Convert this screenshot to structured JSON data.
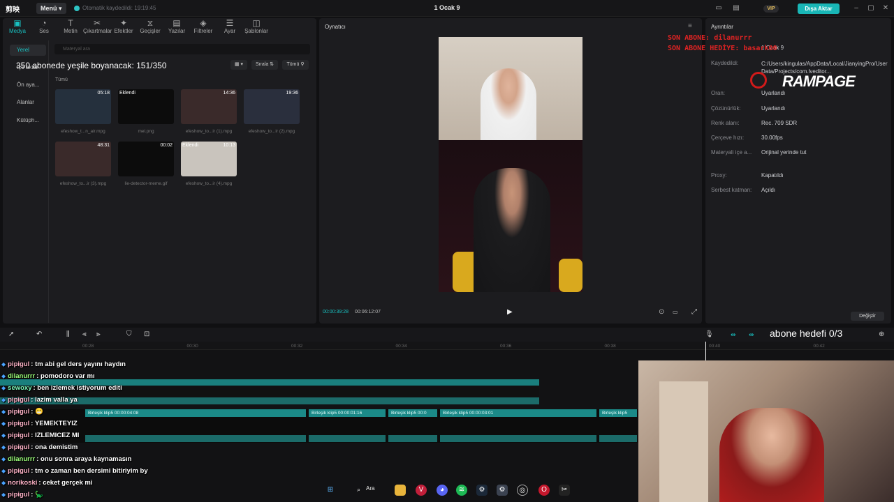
{
  "app": {
    "logo": "剪映",
    "menu_label": "Menü",
    "autosave_text": "Otomatik kaydedildi: 19:19:45",
    "project_title": "1 Ocak 9",
    "vip_label": "VIP",
    "export_label": "Dışa Aktar"
  },
  "toolbar": [
    {
      "label": "Medya",
      "icon": "media-icon"
    },
    {
      "label": "Ses",
      "icon": "audio-icon"
    },
    {
      "label": "Metin",
      "icon": "text-icon"
    },
    {
      "label": "Çıkartmalar",
      "icon": "sticker-icon"
    },
    {
      "label": "Efektler",
      "icon": "effects-icon"
    },
    {
      "label": "Geçişler",
      "icon": "transitions-icon"
    },
    {
      "label": "Yazılar",
      "icon": "captions-icon"
    },
    {
      "label": "Filtreler",
      "icon": "filters-icon"
    },
    {
      "label": "Ayar",
      "icon": "adjust-icon"
    },
    {
      "label": "Şablonlar",
      "icon": "templates-icon"
    }
  ],
  "side_nav": [
    "Yerel",
    "İçe aktar",
    "Ön aya...",
    "Alanlar",
    "Kütüph..."
  ],
  "media": {
    "search_placeholder": "Materyal ara",
    "sort_label": "Sırala",
    "filter_label": "Tümü",
    "all_label": "Tümü",
    "items": [
      {
        "caption": "efeshow_t...n_air.mpg",
        "duration": "05:18",
        "added": ""
      },
      {
        "caption": "mel.png",
        "duration": "",
        "added": "Eklendi"
      },
      {
        "caption": "efeshow_to...ir (1).mpg",
        "duration": "14:36",
        "added": ""
      },
      {
        "caption": "efeshow_to...ir (2).mpg",
        "duration": "19:36",
        "added": ""
      },
      {
        "caption": "efeshow_to...ir (3).mpg",
        "duration": "48:31",
        "added": ""
      },
      {
        "caption": "lie-detector-meme.gif",
        "duration": "00:02",
        "added": ""
      },
      {
        "caption": "efeshow_to...ir (4).mpg",
        "duration": "10:13",
        "added": "Eklendi"
      }
    ]
  },
  "player": {
    "title": "Oynatıcı",
    "current_time": "00:00:39:28",
    "total_time": "00:06:12:07"
  },
  "details": {
    "title": "Ayrıntılar",
    "rows": [
      {
        "label": "",
        "value": "1 Ocak 9"
      },
      {
        "label": "Kaydedildi:",
        "value": "C:/Users/kingulas/AppData/Local/JianyingPro/User Data/Projects/com.lveditor..."
      },
      {
        "label": "Oran:",
        "value": "Uyarlandı"
      },
      {
        "label": "Çözünürlük:",
        "value": "Uyarlandı"
      },
      {
        "label": "Renk alanı:",
        "value": "Rec. 709 SDR"
      },
      {
        "label": "Çerçeve hızı:",
        "value": "30.00fps"
      },
      {
        "label": "Materyali içe a...",
        "value": "Orijinal yerinde tut"
      },
      {
        "label": "Proxy:",
        "value": "Kapatıldı"
      },
      {
        "label": "Serbest katman:",
        "value": "Açıldı"
      }
    ],
    "change_label": "Değiştir"
  },
  "timeline": {
    "ticks": [
      "00:28",
      "00:30",
      "00:32",
      "00:34",
      "00:36",
      "00:38",
      "00:40",
      "00:42"
    ],
    "clips": [
      {
        "label": "Birleşik klip5  00:00:04:08"
      },
      {
        "label": "Birleşik klip5  00:00:01:16"
      },
      {
        "label": "Birleşik klip5  00:0"
      },
      {
        "label": "Birleşik klip5  00:00:03:01"
      },
      {
        "label": "Birleşik klip5"
      }
    ]
  },
  "overlay": {
    "sub_goal": "350 abonede yeşile boyanacak: 151/350",
    "last_sub": "SON ABONE: dilanurrr",
    "last_gift": "SON ABONE HEDİYE: basark00",
    "brand": "RAMPAGE",
    "follow_goal": "abone hedefi 0/3"
  },
  "chat": [
    {
      "user": "pipigul",
      "color": "#ffb3c8",
      "text": "tm abi gel ders yayını haydın"
    },
    {
      "user": "dilanurrr",
      "color": "#9cff7a",
      "text": "pomodoro var mı"
    },
    {
      "user": "sewoxy",
      "color": "#7effc0",
      "text": "ben izlemek istiyorum editi"
    },
    {
      "user": "pipigul",
      "color": "#ffb3c8",
      "text": "lazim valla ya"
    },
    {
      "user": "pipigul",
      "color": "#ffb3c8",
      "text": "😬"
    },
    {
      "user": "pipigul",
      "color": "#ffb3c8",
      "text": "YEMEKTEYIZ"
    },
    {
      "user": "pipigul",
      "color": "#ffb3c8",
      "text": "IZLEMICEZ MI"
    },
    {
      "user": "pipigul",
      "color": "#ffb3c8",
      "text": "ona demistim"
    },
    {
      "user": "dilanurrr",
      "color": "#9cff7a",
      "text": "onu sonra araya kaynamasın"
    },
    {
      "user": "pipigul",
      "color": "#ffb3c8",
      "text": "tm o zaman ben dersimi bitiriyim by"
    },
    {
      "user": "norikoski",
      "color": "#ffb3c8",
      "text": "ceket gerçek mi"
    },
    {
      "user": "pipigul",
      "color": "#ffb3c8",
      "text": "🦕"
    }
  ],
  "taskbar": {
    "search_label": "Ara"
  }
}
